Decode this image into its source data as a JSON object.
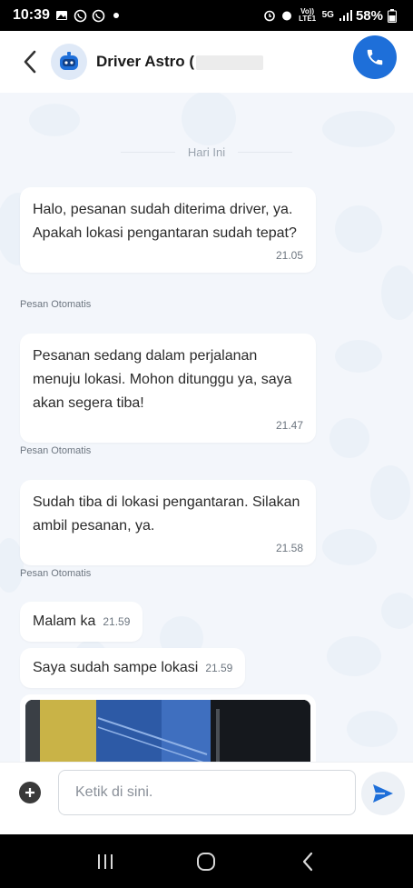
{
  "status_bar": {
    "time": "10:39",
    "battery": "58%",
    "volte_label": "Vo)) LTE1",
    "network_label": "5G"
  },
  "header": {
    "driver_name": "Driver Astro (",
    "back_icon": "chevron-left-icon",
    "call_icon": "phone-icon",
    "accent_color": "#1e6fd9"
  },
  "chat": {
    "date_separator": "Hari Ini",
    "messages": [
      {
        "text": "Halo, pesanan sudah diterima driver, ya. Apakah lokasi pengantaran sudah tepat?",
        "time": "21.05",
        "label": "Pesan Otomatis"
      },
      {
        "text": "Pesanan sedang dalam perjalanan menuju lokasi. Mohon ditunggu ya, saya akan segera tiba!",
        "time": "21.47",
        "label": "Pesan Otomatis"
      },
      {
        "text": "Sudah tiba di lokasi pengantaran. Silakan ambil pesanan, ya.",
        "time": "21.58",
        "label": "Pesan Otomatis"
      },
      {
        "text": "Malam ka",
        "time": "21.59"
      },
      {
        "text": "Saya sudah sampe lokasi",
        "time": "21.59"
      }
    ]
  },
  "input": {
    "placeholder": "Ketik di sini.",
    "plus_icon": "plus-circle-icon",
    "send_icon": "send-icon"
  },
  "nav": {
    "recent_icon": "recent-apps-icon",
    "home_icon": "home-icon",
    "back_icon": "back-icon"
  }
}
